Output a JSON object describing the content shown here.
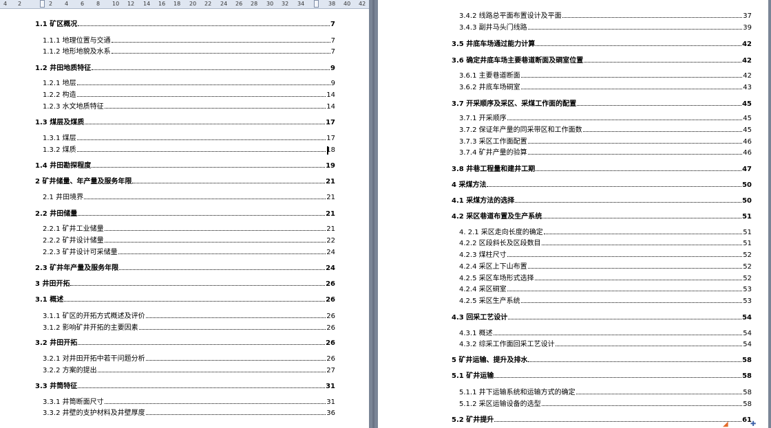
{
  "ruler": {
    "ticks": [
      "4",
      "2",
      "",
      "2",
      "4",
      "6",
      "8",
      "10",
      "12",
      "14",
      "16",
      "18",
      "20",
      "22",
      "24",
      "26",
      "28",
      "30",
      "32",
      "34",
      "",
      "38",
      "40",
      "42"
    ]
  },
  "left_page": {
    "entries": [
      {
        "level": 2,
        "label": "1.1 矿区概况",
        "page": "7"
      },
      {
        "level": 3,
        "label": "1.1.1 地理位置与交通",
        "page": "7"
      },
      {
        "level": 3,
        "label": "1.1.2 地形地貌及水系",
        "page": "7"
      },
      {
        "level": 2,
        "label": "1.2 井田地质特征",
        "page": "9"
      },
      {
        "level": 3,
        "label": "1.2.1 地层",
        "page": "9"
      },
      {
        "level": 3,
        "label": "1.2.2 构造",
        "page": "14"
      },
      {
        "level": 3,
        "label": "1.2.3 水文地质特征",
        "page": "14"
      },
      {
        "level": 2,
        "label": "1.3 煤层及煤质",
        "page": "17"
      },
      {
        "level": 3,
        "label": "1.3.1 煤层",
        "page": "17"
      },
      {
        "level": 3,
        "label": "1.3.2 煤质",
        "page": "18"
      },
      {
        "level": 2,
        "label": "1.4 井田勘探程度",
        "page": "19"
      },
      {
        "level": 2,
        "label": "2 矿井储量、年产量及服务年限",
        "page": "21"
      },
      {
        "level": 3,
        "label": "2.1 井田境界",
        "page": "21"
      },
      {
        "level": 2,
        "label": "2.2 井田储量",
        "page": "21"
      },
      {
        "level": 3,
        "label": "2.2.1 矿井工业储量",
        "page": "21"
      },
      {
        "level": 3,
        "label": "2.2.2 矿井设计储量",
        "page": "22"
      },
      {
        "level": 3,
        "label": "2.2.3 矿井设计可采储量",
        "page": "24"
      },
      {
        "level": 2,
        "label": "2.3 矿井年产量及服务年限",
        "page": "24"
      },
      {
        "level": 2,
        "label": "3 井田开拓",
        "page": "26"
      },
      {
        "level": 2,
        "label": "3.1 概述",
        "page": "26"
      },
      {
        "level": 3,
        "label": "3.1.1 矿区的开拓方式概述及评价",
        "page": "26"
      },
      {
        "level": 3,
        "label": "3.1.2 影响矿井开拓的主要因素",
        "page": "26"
      },
      {
        "level": 2,
        "label": "3.2 井田开拓",
        "page": "26"
      },
      {
        "level": 3,
        "label": "3.2.1 对井田开拓中若干问题分析",
        "page": "26"
      },
      {
        "level": 3,
        "label": "3.2.2 方案的提出",
        "page": "27"
      },
      {
        "level": 2,
        "label": "3.3 井筒特征",
        "page": "31"
      },
      {
        "level": 3,
        "label": "3.3.1 井筒断面尺寸",
        "page": "31"
      },
      {
        "level": 3,
        "label": "3.3.2 井壁的支护材料及井壁厚度",
        "page": "36"
      }
    ]
  },
  "right_page": {
    "entries": [
      {
        "level": 3,
        "label": "3.4.2 线路总平面布置设计及平面",
        "page": "37"
      },
      {
        "level": 3,
        "label": "3.4.3 副井马头门线路",
        "page": "39"
      },
      {
        "level": 2,
        "label": "3.5 井底车场通过能力计算",
        "page": "42"
      },
      {
        "level": 2,
        "label": "3.6 确定井底车场主要巷道断面及硐室位置",
        "page": "42"
      },
      {
        "level": 3,
        "label": "3.6.1 主要巷道断面",
        "page": "42"
      },
      {
        "level": 3,
        "label": "3.6.2 井底车场硐室",
        "page": "43"
      },
      {
        "level": 2,
        "label": "3.7 开采顺序及采区、采煤工作面的配置",
        "page": "45"
      },
      {
        "level": 3,
        "label": "3.7.1 开采顺序",
        "page": "45"
      },
      {
        "level": 3,
        "label": "3.7.2 保证年产量的同采带区和工作面数",
        "page": "45"
      },
      {
        "level": 3,
        "label": "3.7.3 采区工作面配置",
        "page": "46"
      },
      {
        "level": 3,
        "label": "3.7.4 矿井产量的验算",
        "page": "46"
      },
      {
        "level": 2,
        "label": "3.8 井巷工程量和建井工期",
        "page": "47"
      },
      {
        "level": 2,
        "label": "4 采煤方法",
        "page": "50"
      },
      {
        "level": 2,
        "label": "4.1 采煤方法的选择",
        "page": "50"
      },
      {
        "level": 2,
        "label": "4.2 采区巷道布置及生产系统",
        "page": "51"
      },
      {
        "level": 3,
        "label": "4. 2.1 采区走向长度的确定",
        "page": "51"
      },
      {
        "level": 3,
        "label": "4.2.2 区段斜长及区段数目",
        "page": "51"
      },
      {
        "level": 3,
        "label": "4.2.3 煤柱尺寸",
        "page": "52"
      },
      {
        "level": 3,
        "label": "4.2.4 采区上下山布置",
        "page": "52"
      },
      {
        "level": 3,
        "label": "4.2.5 采区车场形式选择",
        "page": "52"
      },
      {
        "level": 3,
        "label": "4.2.4 采区硐室",
        "page": "53"
      },
      {
        "level": 3,
        "label": "4.2.5 采区生产系统",
        "page": "53"
      },
      {
        "level": 2,
        "label": "4.3 回采工艺设计",
        "page": "54"
      },
      {
        "level": 3,
        "label": "4.3.1 概述",
        "page": "54"
      },
      {
        "level": 3,
        "label": "4.3.2 综采工作面回采工艺设计",
        "page": "54"
      },
      {
        "level": 2,
        "label": "5 矿井运输、提升及排水",
        "page": "58"
      },
      {
        "level": 2,
        "label": "5.1 矿井运输",
        "page": "58"
      },
      {
        "level": 3,
        "label": "5.1.1 井下运输系统和运输方式的确定",
        "page": "58"
      },
      {
        "level": 3,
        "label": "5.1.2 采区运输设备的选型",
        "page": "58"
      },
      {
        "level": 2,
        "label": "5.2 矿井提升",
        "page": "61"
      }
    ]
  },
  "status_icons": [
    "s-icon",
    "brand-icon"
  ]
}
